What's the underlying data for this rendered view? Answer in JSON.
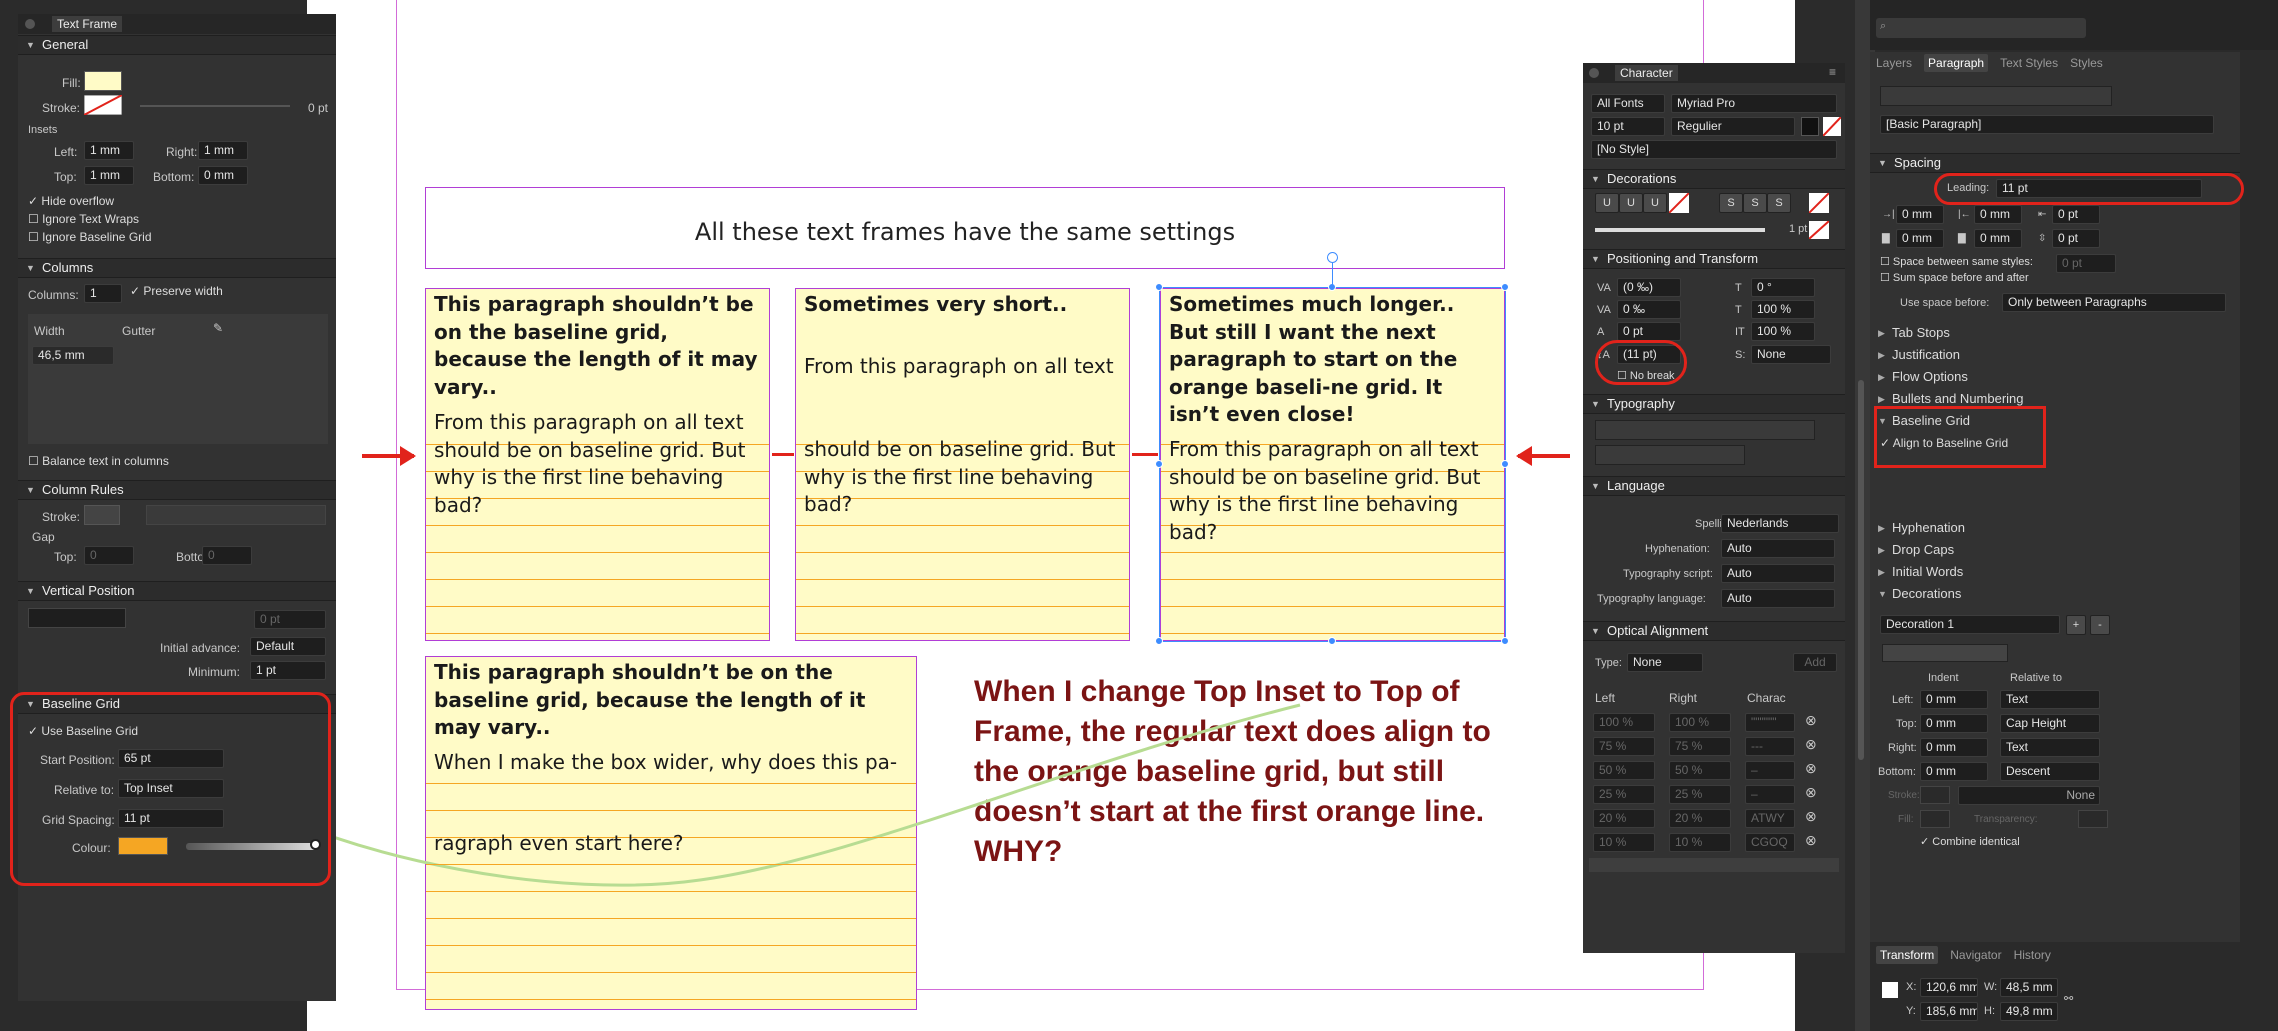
{
  "text_frame_panel": {
    "title": "Text Frame",
    "general": {
      "header": "General",
      "fill_label": "Fill:",
      "stroke_label": "Stroke:",
      "stroke_value": "0 pt",
      "insets_label": "Insets",
      "left_label": "Left:",
      "left_value": "1 mm",
      "right_label": "Right:",
      "right_value": "1 mm",
      "top_label": "Top:",
      "top_value": "1 mm",
      "bottom_label": "Bottom:",
      "bottom_value": "0 mm",
      "hide_overflow": "Hide overflow",
      "ignore_text_wraps": "Ignore Text Wraps",
      "ignore_baseline_grid": "Ignore Baseline Grid"
    },
    "columns": {
      "header": "Columns",
      "columns_label": "Columns:",
      "columns_value": "1",
      "preserve_width": "Preserve width",
      "width_header": "Width",
      "gutter_header": "Gutter",
      "width_value": "46,5 mm",
      "balance": "Balance text in columns"
    },
    "column_rules": {
      "header": "Column Rules",
      "stroke_label": "Stroke:",
      "gap_label": "Gap",
      "top_label": "Top:",
      "top_value": "0",
      "bottom_label": "Bottom:",
      "bottom_value": "0"
    },
    "vertical_position": {
      "header": "Vertical Position",
      "pt_value": "0 pt",
      "initial_advance_label": "Initial advance:",
      "initial_advance_value": "Default",
      "minimum_label": "Minimum:",
      "minimum_value": "1 pt"
    },
    "baseline_grid": {
      "header": "Baseline Grid",
      "use_baseline_grid": "Use Baseline Grid",
      "start_position_label": "Start Position:",
      "start_position_value": "65 pt",
      "relative_to_label": "Relative to:",
      "relative_to_value": "Top Inset",
      "grid_spacing_label": "Grid Spacing:",
      "grid_spacing_value": "11 pt",
      "colour_label": "Colour:"
    }
  },
  "canvas": {
    "title_frame_text": "All these text frames have the same settings",
    "frame1": {
      "heading": "This paragraph shouldn’t be on the baseline grid, because the length of it may vary..",
      "body": "From this paragraph on all text should be on baseline grid. But why is the first line behaving bad?"
    },
    "frame2": {
      "heading": "Sometimes very short..",
      "body1": "From this paragraph on all text",
      "body2": "should be on baseline grid. But why is the first line behaving bad?"
    },
    "frame3": {
      "heading": "Sometimes much longer..  But still I want the next paragraph to start on the orange baseli-ne grid. It isn’t even close!",
      "body": "From this paragraph on all text should be on baseline grid. But why is the first line behaving bad?"
    },
    "frame4": {
      "heading": "This paragraph shouldn’t be on the baseline grid, because the length of it may vary..",
      "body1": "When I make the box wider, why does this pa-",
      "body2": "ragraph even start here?"
    },
    "annotation": "When I change Top Inset to Top of Frame, the regular text does align to the orange baseline grid, but still doesn’t start at the first orange line. WHY?"
  },
  "character_panel": {
    "title": "Character",
    "font_collection": "All Fonts",
    "font_family": "Myriad Pro",
    "font_size": "10 pt",
    "font_style": "Regulier",
    "style": "[No Style]",
    "decorations": {
      "header": "Decorations",
      "stroke_value": "1 pt"
    },
    "positioning": {
      "header": "Positioning and Transform",
      "kerning": "(0 ‰)",
      "tracking": "0 ‰",
      "baseline_shift": "0 pt",
      "leading": "(11 pt)",
      "no_break": "No break",
      "shear": "0 °",
      "scale_h": "100 %",
      "scale_v": "100 %",
      "caps": "None"
    },
    "typography": {
      "header": "Typography"
    },
    "language": {
      "header": "Language",
      "spelling_label": "Spelling:",
      "spelling_value": "Nederlands",
      "hyphenation_label": "Hyphenation:",
      "hyphenation_value": "Auto",
      "script_label": "Typography script:",
      "script_value": "Auto",
      "lang_label": "Typography language:",
      "lang_value": "Auto"
    },
    "optical": {
      "header": "Optical Alignment",
      "type_label": "Type:",
      "type_value": "None",
      "add_label": "Add",
      "col_left": "Left",
      "col_right": "Right",
      "col_chars": "Charac",
      "rows": [
        {
          "l": "100 %",
          "r": "100 %",
          "c": "\"\"\"\"\"\""
        },
        {
          "l": "75 %",
          "r": "75 %",
          "c": "---"
        },
        {
          "l": "50 %",
          "r": "50 %",
          "c": "–"
        },
        {
          "l": "25 %",
          "r": "25 %",
          "c": "–"
        },
        {
          "l": "20 %",
          "r": "20 %",
          "c": "ATWY"
        },
        {
          "l": "10 %",
          "r": "10 %",
          "c": "CGOQ"
        }
      ]
    }
  },
  "paragraph_panel": {
    "tabs": [
      "Layers",
      "Paragraph",
      "Text Styles",
      "Styles"
    ],
    "active_tab": "Paragraph",
    "style": "[Basic Paragraph]",
    "spacing": {
      "header": "Spacing",
      "leading_label": "Leading:",
      "leading_value": "11 pt",
      "v1": "0 mm",
      "v2": "0 mm",
      "v3": "0 pt",
      "v4": "0 mm",
      "v5": "0 mm",
      "v6": "0 pt",
      "space_between": "Space between same styles:",
      "space_between_value": "0 pt",
      "sum_space": "Sum space before and after",
      "use_space_label": "Use space before:",
      "use_space_value": "Only between Paragraphs"
    },
    "sections": [
      "Tab Stops",
      "Justification",
      "Flow Options",
      "Bullets and Numbering"
    ],
    "baseline_grid": {
      "header": "Baseline Grid",
      "align": "Align to Baseline Grid"
    },
    "sections2": [
      "Hyphenation",
      "Drop Caps",
      "Initial Words"
    ],
    "decorations": {
      "header": "Decorations",
      "selector": "Decoration 1",
      "indent_label": "Indent",
      "relative_label": "Relative to",
      "left_label": "Left:",
      "left_value": "0 mm",
      "left_rel": "Text",
      "top_label": "Top:",
      "top_value": "0 mm",
      "top_rel": "Cap Height",
      "right_label": "Right:",
      "right_value": "0 mm",
      "right_rel": "Text",
      "bottom_label": "Bottom:",
      "bottom_value": "0 mm",
      "bottom_rel": "Descent",
      "stroke_label": "Stroke:",
      "stroke_value": "None",
      "fill_label": "Fill:",
      "transparency_label": "Transparency:",
      "combine": "Combine identical"
    }
  },
  "transform_panel": {
    "tabs": [
      "Transform",
      "Navigator",
      "History"
    ],
    "active_tab": "Transform",
    "x_label": "X:",
    "x_value": "120,6 mm",
    "y_label": "Y:",
    "y_value": "185,6 mm",
    "w_label": "W:",
    "w_value": "48,5 mm",
    "h_label": "H:",
    "h_value": "49,8 mm"
  },
  "colors": {
    "accent_red": "#e1231b",
    "frame_border": "#b13ed6",
    "frame_fill": "#fffbc7",
    "grid_orange": "#f5a623",
    "annotation": "#7b1414"
  }
}
